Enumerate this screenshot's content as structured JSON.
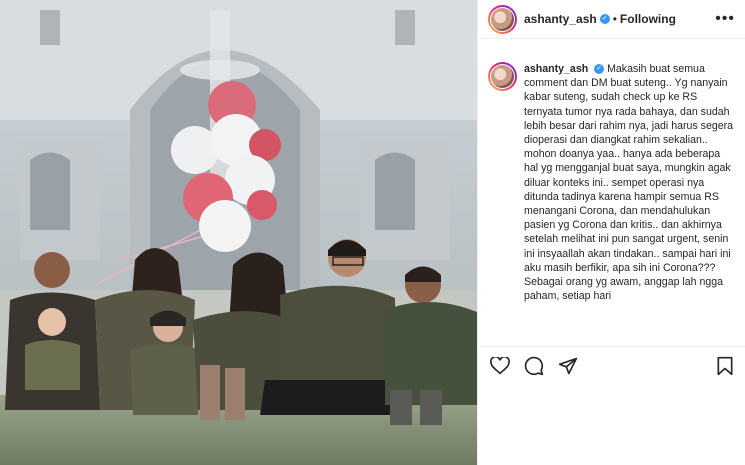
{
  "post": {
    "username": "ashanty_ash",
    "verified_icon": "verified-badge-icon",
    "follow_status": "Following",
    "more_icon": "more-options-icon"
  },
  "caption": {
    "username": "ashanty_ash",
    "text": "Makasih buat semua comment dan DM buat suteng.. Yg nanyain kabar suteng, sudah check up ke RS ternyata tumor nya rada bahaya, dan sudah lebih besar dari rahim nya, jadi harus segera dioperasi dan diangkat rahim sekalian.. mohon doanya yaa.. hanya ada beberapa hal yg mengganjal buat saya, mungkin agak diluar konteks ini.. sempet operasi nya ditunda tadinya karena hampir semua RS menangani Corona, dan mendahulukan pasien yg Corona dan kritis.. dan akhirnya setelah melihat ini pun sangat urgent, senin ini insyaallah akan tindakan.. sampai hari ini aku masih berfikir, apa sih ini Corona??? Sebagai orang yg awam, anggap lah ngga paham, setiap hari"
  },
  "actions": {
    "like_icon": "heart-icon",
    "comment_icon": "comment-icon",
    "share_icon": "share-icon",
    "save_icon": "bookmark-icon"
  },
  "colors": {
    "verified": "#3897f0",
    "text": "#262626",
    "border": "#efefef"
  }
}
